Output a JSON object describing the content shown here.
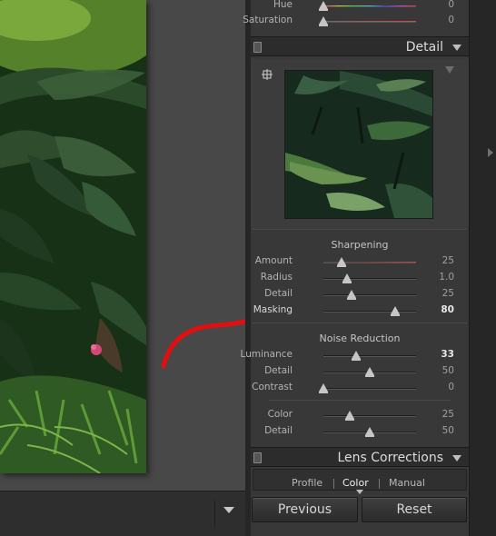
{
  "color_panel": {
    "rows": [
      {
        "label": "Hue",
        "value": "0",
        "position": 0.0
      },
      {
        "label": "Saturation",
        "value": "0",
        "position": 0.0
      }
    ]
  },
  "detail": {
    "header_title": "Detail",
    "sharpening": {
      "title": "Sharpening",
      "rows": [
        {
          "label": "Amount",
          "value": "25",
          "position": 0.2,
          "track": "red"
        },
        {
          "label": "Radius",
          "value": "1.0",
          "position": 0.25
        },
        {
          "label": "Detail",
          "value": "25",
          "position": 0.3
        },
        {
          "label": "Masking",
          "value": "80",
          "position": 0.77,
          "highlighted": true
        }
      ]
    },
    "noise_reduction": {
      "title": "Noise Reduction",
      "rows": [
        {
          "label": "Luminance",
          "value": "33",
          "position": 0.35,
          "highlighted": true
        },
        {
          "label": "Detail",
          "value": "50",
          "position": 0.5
        },
        {
          "label": "Contrast",
          "value": "0",
          "position": 0.0
        },
        {
          "label": "Color",
          "value": "25",
          "position": 0.28
        },
        {
          "label": "Detail",
          "value": "50",
          "position": 0.5
        }
      ]
    }
  },
  "lens_corrections": {
    "header_title": "Lens Corrections",
    "tabs": [
      "Profile",
      "Color",
      "Manual"
    ],
    "active_tab": "Color"
  },
  "buttons": {
    "previous_label": "Previous",
    "reset_label": "Reset"
  },
  "icons": {
    "target": "target-adjustment-icon",
    "panel_switch": "panel-toggle-switch-icon",
    "collapse": "triangle-down-icon",
    "expand_right": "triangle-right-icon"
  },
  "colors": {
    "annotation_arrow": "#e01010",
    "panel_bg": "#383838",
    "header_bg": "#2c2c2c"
  }
}
